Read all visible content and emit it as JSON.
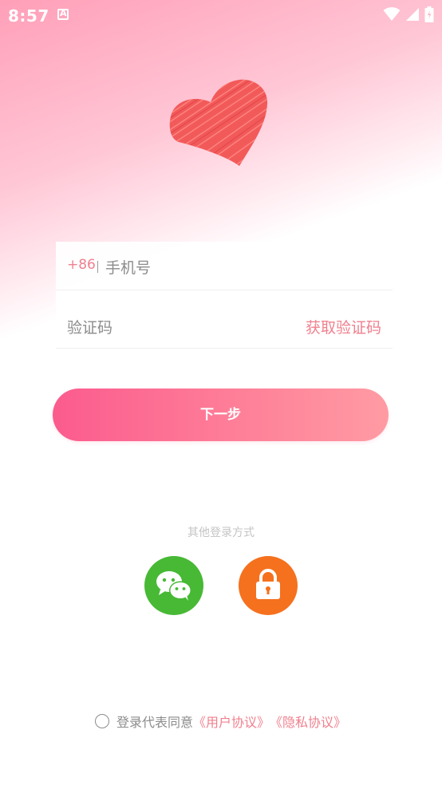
{
  "status_bar": {
    "time": "8:57",
    "icons": [
      "notification-a-icon",
      "wifi-icon",
      "signal-icon",
      "battery-icon"
    ]
  },
  "hero": {
    "icon": "heart-icon"
  },
  "form": {
    "country_code": "+86",
    "phone_placeholder": "手机号",
    "code_placeholder": "验证码",
    "get_code_label": "获取验证码"
  },
  "next_button": {
    "label": "下一步"
  },
  "other_login": {
    "label": "其他登录方式",
    "options": [
      "wechat-icon",
      "lock-icon"
    ]
  },
  "agreement": {
    "text": "登录代表同意",
    "user_agreement": "《用户协议》",
    "privacy_agreement": "《隐私协议》"
  },
  "colors": {
    "accent": "#f0808e",
    "button_start": "#fb5b8e",
    "button_end": "#ff9ba3",
    "wechat": "#47b935",
    "lock": "#f5711e"
  }
}
